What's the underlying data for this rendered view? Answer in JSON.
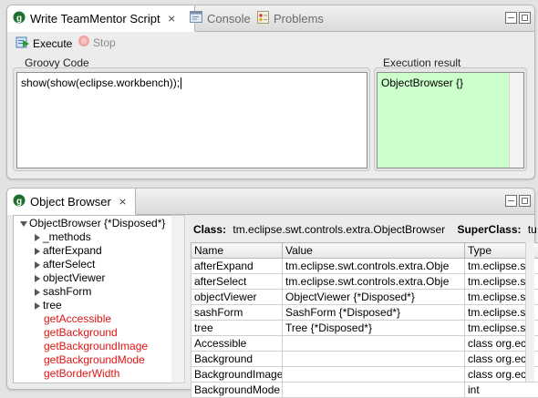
{
  "top_panel": {
    "tabs": [
      {
        "label": "Write TeamMentor Script",
        "icon": "teammentor-icon",
        "active": true
      },
      {
        "label": "Console",
        "icon": "console-icon",
        "active": false
      },
      {
        "label": "Problems",
        "icon": "problems-icon",
        "active": false
      }
    ],
    "toolbar": {
      "execute_label": "Execute",
      "stop_label": "Stop"
    },
    "groovy_label": "Groovy Code",
    "code": "show(show(eclipse.workbench));",
    "result_label": "Execution result",
    "result": "ObjectBrowser {}"
  },
  "bottom_panel": {
    "tab_label": "Object Browser",
    "tree": [
      {
        "label": "ObjectBrowser {*Disposed*}",
        "type": "root"
      },
      {
        "label": "_methods",
        "type": "node"
      },
      {
        "label": "afterExpand",
        "type": "node"
      },
      {
        "label": "afterSelect",
        "type": "node"
      },
      {
        "label": "objectViewer",
        "type": "node"
      },
      {
        "label": "sashForm",
        "type": "node"
      },
      {
        "label": "tree",
        "type": "node"
      },
      {
        "label": "getAccessible",
        "type": "method"
      },
      {
        "label": "getBackground",
        "type": "method"
      },
      {
        "label": "getBackgroundImage",
        "type": "method"
      },
      {
        "label": "getBackgroundMode",
        "type": "method"
      },
      {
        "label": "getBorderWidth",
        "type": "method"
      }
    ],
    "class_label": "Class:",
    "class_value": "tm.eclipse.swt.controls.extra.ObjectBrowser",
    "superclass_label": "SuperClass:",
    "superclass_value": "tu",
    "columns": [
      "Name",
      "Value",
      "Type"
    ],
    "rows": [
      [
        "afterExpand",
        "tm.eclipse.swt.controls.extra.Obje",
        "tm.eclipse.sw"
      ],
      [
        "afterSelect",
        "tm.eclipse.swt.controls.extra.Obje",
        "tm.eclipse.sw"
      ],
      [
        "objectViewer",
        "ObjectViewer {*Disposed*}",
        "tm.eclipse.sw"
      ],
      [
        "sashForm",
        "SashForm {*Disposed*}",
        "tm.eclipse.sw"
      ],
      [
        "tree",
        "Tree {*Disposed*}",
        "tm.eclipse.sw"
      ],
      [
        "Accessible",
        "",
        "class org.ecl"
      ],
      [
        "Background",
        "",
        "class org.ecl"
      ],
      [
        "BackgroundImage",
        "",
        "class org.ecl"
      ],
      [
        "BackgroundMode",
        "",
        "int"
      ]
    ]
  },
  "colors": {
    "result_bg": "#ccffcc",
    "method_text": "#e01414",
    "selection": "#3875d7"
  }
}
